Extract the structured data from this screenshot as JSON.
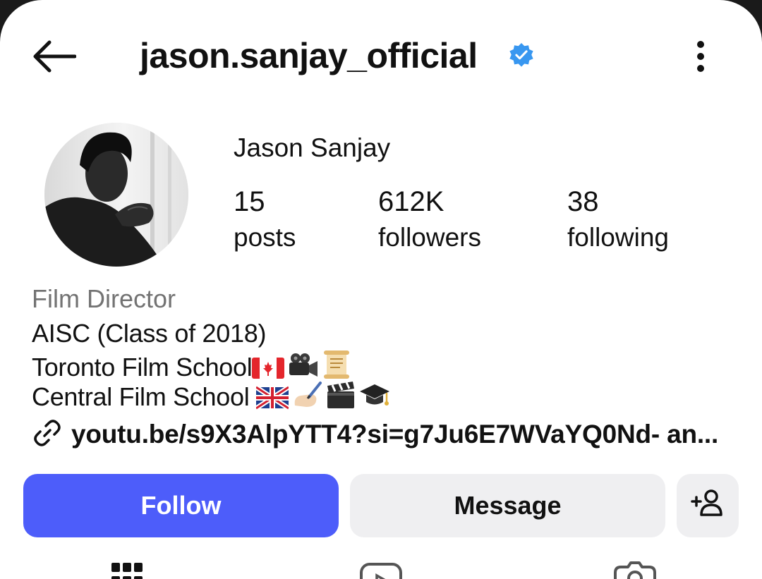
{
  "header": {
    "username": "jason.sanjay_official",
    "verified_color": "#3897f0"
  },
  "profile": {
    "display_name": "Jason Sanjay",
    "stats": [
      {
        "value": "15",
        "label": "posts"
      },
      {
        "value": "612K",
        "label": "followers"
      },
      {
        "value": "38",
        "label": "following"
      }
    ],
    "category": "Film Director",
    "bio": {
      "line1": "AISC (Class of 2018)",
      "line2": "Toronto Film School",
      "line3": "Central Film School "
    },
    "link": "youtu.be/s9X3AlpYTT4?si=g7Ju6E7WVaYQ0Nd- an..."
  },
  "actions": {
    "follow": "Follow",
    "message": "Message"
  },
  "colors": {
    "follow_button": "#4d5dfa",
    "secondary_button": "#efeff1",
    "muted_text": "#737373"
  },
  "icons": [
    "back-arrow-icon",
    "verified-badge-icon",
    "more-options-icon",
    "link-icon",
    "add-person-icon",
    "grid-icon",
    "reels-icon",
    "tagged-icon"
  ]
}
